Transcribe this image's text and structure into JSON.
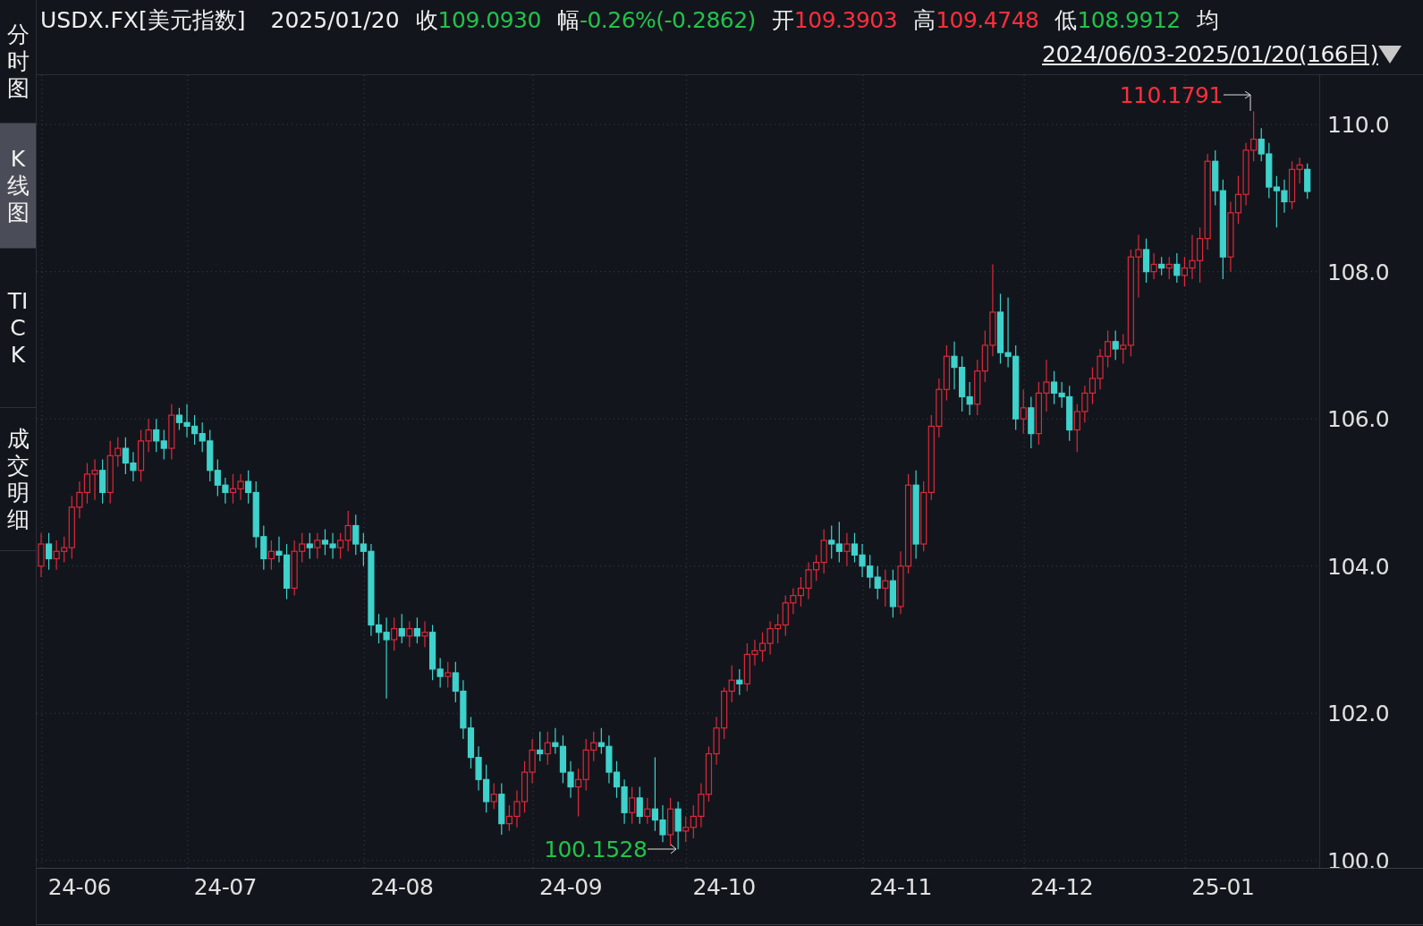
{
  "sidebar": {
    "tabs": [
      {
        "label": "分时图",
        "selected": false
      },
      {
        "label": "K线图",
        "selected": true
      },
      {
        "label": "TICK",
        "selected": false
      },
      {
        "label": "成交明细",
        "selected": false
      }
    ]
  },
  "header": {
    "symbol": "USDX.FX[美元指数]",
    "date": "2025/01/20",
    "quotes": [
      {
        "label": "收",
        "value": "109.0930",
        "color": "#22c24a"
      },
      {
        "label": "幅",
        "value": "-0.26%(-0.2862)",
        "color": "#22c24a"
      },
      {
        "label": "开",
        "value": "109.3903",
        "color": "#ff2e3c"
      },
      {
        "label": "高",
        "value": "109.4748",
        "color": "#ff2e3c"
      },
      {
        "label": "低",
        "value": "108.9912",
        "color": "#22c24a"
      },
      {
        "label": "均"
      }
    ],
    "range": "2024/06/03-2025/01/20(166日)"
  },
  "chart": {
    "chart_data": {
      "type": "candlestick",
      "yticks": [
        {
          "value": 110,
          "label": "110.0"
        },
        {
          "value": 108,
          "label": "108.0"
        },
        {
          "value": 106,
          "label": "106.0"
        },
        {
          "value": 104,
          "label": "104.0"
        },
        {
          "value": 102,
          "label": "102.0"
        },
        {
          "value": 100,
          "label": "100.0"
        }
      ],
      "ylim": [
        99.9,
        110.67
      ],
      "grid": true,
      "annotations": [
        "110.1791",
        "100.1528"
      ],
      "categories": [
        null,
        null,
        null,
        null,
        null,
        "24-06",
        null,
        null,
        null,
        null,
        null,
        null,
        null,
        null,
        null,
        null,
        null,
        null,
        null,
        null,
        null,
        null,
        null,
        null,
        "24-07",
        null,
        null,
        null,
        null,
        null,
        null,
        null,
        null,
        null,
        null,
        null,
        null,
        null,
        null,
        null,
        null,
        null,
        null,
        null,
        null,
        null,
        null,
        "24-08",
        null,
        null,
        null,
        null,
        null,
        null,
        null,
        null,
        null,
        null,
        null,
        null,
        null,
        null,
        null,
        null,
        null,
        null,
        null,
        null,
        null,
        "24-09",
        null,
        null,
        null,
        null,
        null,
        null,
        null,
        null,
        null,
        null,
        null,
        null,
        null,
        null,
        null,
        null,
        null,
        null,
        null,
        "24-10",
        null,
        null,
        null,
        null,
        null,
        null,
        null,
        null,
        null,
        null,
        null,
        null,
        null,
        null,
        null,
        null,
        null,
        null,
        null,
        null,
        null,
        null,
        "24-11",
        null,
        null,
        null,
        null,
        null,
        null,
        null,
        null,
        null,
        null,
        null,
        null,
        null,
        null,
        null,
        null,
        null,
        null,
        null,
        null,
        "24-12",
        null,
        null,
        null,
        null,
        null,
        null,
        null,
        null,
        null,
        null,
        null,
        null,
        null,
        null,
        null,
        null,
        null,
        null,
        null,
        null,
        "25-01",
        null,
        null,
        null,
        null,
        null,
        null,
        null,
        null,
        null,
        null,
        null
      ],
      "ohlc": [
        [
          104.0,
          104.45,
          103.85,
          104.3
        ],
        [
          104.3,
          104.45,
          103.95,
          104.1
        ],
        [
          104.1,
          104.35,
          103.95,
          104.2
        ],
        [
          104.2,
          104.4,
          104.05,
          104.25
        ],
        [
          104.25,
          104.95,
          104.1,
          104.8
        ],
        [
          104.8,
          105.15,
          104.65,
          105.0
        ],
        [
          105.0,
          105.4,
          104.85,
          105.25
        ],
        [
          105.25,
          105.45,
          104.9,
          105.3
        ],
        [
          105.3,
          105.45,
          104.85,
          105.0
        ],
        [
          105.0,
          105.7,
          104.85,
          105.5
        ],
        [
          105.5,
          105.75,
          105.35,
          105.6
        ],
        [
          105.6,
          105.75,
          105.25,
          105.4
        ],
        [
          105.4,
          105.55,
          105.15,
          105.3
        ],
        [
          105.3,
          105.85,
          105.15,
          105.7
        ],
        [
          105.7,
          106.0,
          105.55,
          105.85
        ],
        [
          105.85,
          106.0,
          105.55,
          105.7
        ],
        [
          105.7,
          105.85,
          105.45,
          105.6
        ],
        [
          105.6,
          106.2,
          105.45,
          106.05
        ],
        [
          106.05,
          106.15,
          105.85,
          105.95
        ],
        [
          105.95,
          106.2,
          105.75,
          105.9
        ],
        [
          105.9,
          106.05,
          105.65,
          105.8
        ],
        [
          105.8,
          105.95,
          105.55,
          105.7
        ],
        [
          105.7,
          105.85,
          105.15,
          105.3
        ],
        [
          105.3,
          105.45,
          104.95,
          105.1
        ],
        [
          105.1,
          105.2,
          104.85,
          105.0
        ],
        [
          105.0,
          105.25,
          104.85,
          105.05
        ],
        [
          105.05,
          105.25,
          104.9,
          105.15
        ],
        [
          105.15,
          105.3,
          104.85,
          105.0
        ],
        [
          105.0,
          105.15,
          104.25,
          104.4
        ],
        [
          104.4,
          104.55,
          103.95,
          104.1
        ],
        [
          104.1,
          104.35,
          103.95,
          104.2
        ],
        [
          104.2,
          104.4,
          104.05,
          104.15
        ],
        [
          104.15,
          104.3,
          103.55,
          103.7
        ],
        [
          103.7,
          104.35,
          103.6,
          104.2
        ],
        [
          104.2,
          104.45,
          104.05,
          104.3
        ],
        [
          104.3,
          104.45,
          104.1,
          104.25
        ],
        [
          104.25,
          104.45,
          104.1,
          104.35
        ],
        [
          104.35,
          104.5,
          104.15,
          104.3
        ],
        [
          104.3,
          104.45,
          104.1,
          104.25
        ],
        [
          104.25,
          104.45,
          104.1,
          104.35
        ],
        [
          104.35,
          104.75,
          104.2,
          104.55
        ],
        [
          104.55,
          104.7,
          104.15,
          104.3
        ],
        [
          104.3,
          104.45,
          104.0,
          104.2
        ],
        [
          104.2,
          104.3,
          103.05,
          103.2
        ],
        [
          103.2,
          103.35,
          102.95,
          103.1
        ],
        [
          103.1,
          103.3,
          102.2,
          103.0
        ],
        [
          103.0,
          103.3,
          102.85,
          103.15
        ],
        [
          103.15,
          103.35,
          102.95,
          103.05
        ],
        [
          103.05,
          103.25,
          102.9,
          103.15
        ],
        [
          103.15,
          103.3,
          102.95,
          103.05
        ],
        [
          103.05,
          103.25,
          102.9,
          103.1
        ],
        [
          103.1,
          103.2,
          102.45,
          102.6
        ],
        [
          102.6,
          102.75,
          102.35,
          102.5
        ],
        [
          102.5,
          102.7,
          102.35,
          102.55
        ],
        [
          102.55,
          102.7,
          102.15,
          102.3
        ],
        [
          102.3,
          102.45,
          101.65,
          101.8
        ],
        [
          101.8,
          101.95,
          101.25,
          101.4
        ],
        [
          101.4,
          101.55,
          100.95,
          101.1
        ],
        [
          101.1,
          101.3,
          100.65,
          100.8
        ],
        [
          100.8,
          101.05,
          100.7,
          100.9
        ],
        [
          100.9,
          101.05,
          100.35,
          100.5
        ],
        [
          100.5,
          100.75,
          100.4,
          100.6
        ],
        [
          100.6,
          100.95,
          100.45,
          100.8
        ],
        [
          100.8,
          101.35,
          100.65,
          101.2
        ],
        [
          101.2,
          101.65,
          101.05,
          101.5
        ],
        [
          101.5,
          101.75,
          101.35,
          101.45
        ],
        [
          101.45,
          101.75,
          101.3,
          101.6
        ],
        [
          101.6,
          101.8,
          101.45,
          101.55
        ],
        [
          101.55,
          101.7,
          101.05,
          101.2
        ],
        [
          101.2,
          101.35,
          100.85,
          101.0
        ],
        [
          101.0,
          101.25,
          100.6,
          101.1
        ],
        [
          101.1,
          101.65,
          100.95,
          101.5
        ],
        [
          101.5,
          101.75,
          101.35,
          101.6
        ],
        [
          101.6,
          101.8,
          101.45,
          101.55
        ],
        [
          101.55,
          101.7,
          101.05,
          101.2
        ],
        [
          101.2,
          101.35,
          100.85,
          101.0
        ],
        [
          101.0,
          101.1,
          100.5,
          100.65
        ],
        [
          100.65,
          101.0,
          100.5,
          100.85
        ],
        [
          100.85,
          101.0,
          100.5,
          100.6
        ],
        [
          100.6,
          100.85,
          100.5,
          100.7
        ],
        [
          100.7,
          101.4,
          100.4,
          100.55
        ],
        [
          100.55,
          100.75,
          100.25,
          100.35
        ],
        [
          100.35,
          100.85,
          100.2,
          100.7
        ],
        [
          100.7,
          100.8,
          100.1528,
          100.4
        ],
        [
          100.4,
          100.6,
          100.25,
          100.45
        ],
        [
          100.45,
          100.75,
          100.3,
          100.6
        ],
        [
          100.6,
          101.05,
          100.45,
          100.9
        ],
        [
          100.9,
          101.55,
          100.8,
          101.45
        ],
        [
          101.45,
          101.95,
          101.3,
          101.8
        ],
        [
          101.8,
          102.35,
          101.65,
          102.3
        ],
        [
          102.3,
          102.65,
          102.15,
          102.45
        ],
        [
          102.45,
          102.6,
          102.25,
          102.4
        ],
        [
          102.4,
          102.95,
          102.3,
          102.8
        ],
        [
          102.8,
          103.0,
          102.65,
          102.85
        ],
        [
          102.85,
          103.1,
          102.7,
          102.95
        ],
        [
          102.95,
          103.25,
          102.8,
          103.15
        ],
        [
          103.15,
          103.35,
          102.95,
          103.2
        ],
        [
          103.2,
          103.6,
          103.05,
          103.5
        ],
        [
          103.5,
          103.7,
          103.35,
          103.6
        ],
        [
          103.6,
          103.85,
          103.45,
          103.7
        ],
        [
          103.7,
          104.05,
          103.55,
          103.95
        ],
        [
          103.95,
          104.15,
          103.8,
          104.05
        ],
        [
          104.05,
          104.5,
          103.9,
          104.35
        ],
        [
          104.35,
          104.55,
          104.1,
          104.3
        ],
        [
          104.3,
          104.6,
          104.05,
          104.2
        ],
        [
          104.2,
          104.45,
          104.0,
          104.3
        ],
        [
          104.3,
          104.45,
          104.05,
          104.15
        ],
        [
          104.15,
          104.3,
          103.85,
          104.0
        ],
        [
          104.0,
          104.15,
          103.7,
          103.85
        ],
        [
          103.85,
          104.0,
          103.55,
          103.7
        ],
        [
          103.7,
          103.95,
          103.45,
          103.8
        ],
        [
          103.8,
          103.95,
          103.3,
          103.45
        ],
        [
          103.45,
          104.2,
          103.35,
          104.0
        ],
        [
          104.0,
          105.25,
          103.9,
          105.1
        ],
        [
          105.1,
          105.3,
          104.1,
          104.3
        ],
        [
          104.3,
          105.15,
          104.2,
          105.0
        ],
        [
          105.0,
          106.05,
          104.9,
          105.9
        ],
        [
          105.9,
          106.55,
          105.75,
          106.4
        ],
        [
          106.4,
          107.0,
          106.25,
          106.85
        ],
        [
          106.85,
          107.05,
          106.4,
          106.7
        ],
        [
          106.7,
          106.85,
          106.1,
          106.3
        ],
        [
          106.3,
          106.5,
          106.05,
          106.2
        ],
        [
          106.2,
          106.8,
          106.05,
          106.65
        ],
        [
          106.65,
          107.2,
          106.5,
          107.0
        ],
        [
          107.0,
          108.1,
          106.85,
          107.45
        ],
        [
          107.45,
          107.7,
          106.75,
          106.9
        ],
        [
          106.9,
          107.65,
          106.7,
          106.85
        ],
        [
          106.85,
          107.0,
          105.85,
          106.0
        ],
        [
          106.0,
          106.4,
          105.8,
          106.15
        ],
        [
          106.15,
          106.3,
          105.6,
          105.8
        ],
        [
          105.8,
          106.5,
          105.65,
          106.35
        ],
        [
          106.35,
          106.8,
          106.1,
          106.5
        ],
        [
          106.5,
          106.65,
          106.2,
          106.35
        ],
        [
          106.35,
          106.5,
          106.15,
          106.3
        ],
        [
          106.3,
          106.45,
          105.7,
          105.85
        ],
        [
          105.85,
          106.2,
          105.55,
          106.1
        ],
        [
          106.1,
          106.45,
          105.95,
          106.35
        ],
        [
          106.35,
          106.7,
          106.2,
          106.55
        ],
        [
          106.55,
          106.95,
          106.4,
          106.85
        ],
        [
          106.85,
          107.2,
          106.7,
          107.05
        ],
        [
          107.05,
          107.2,
          106.8,
          106.95
        ],
        [
          106.95,
          107.15,
          106.75,
          107.0
        ],
        [
          107.0,
          108.3,
          106.85,
          108.2
        ],
        [
          108.2,
          108.5,
          107.65,
          108.3
        ],
        [
          108.3,
          108.45,
          107.85,
          108.0
        ],
        [
          108.0,
          108.25,
          107.9,
          108.1
        ],
        [
          108.1,
          108.2,
          107.95,
          108.05
        ],
        [
          108.05,
          108.2,
          107.9,
          108.1
        ],
        [
          108.1,
          108.25,
          107.85,
          107.95
        ],
        [
          107.95,
          108.2,
          107.8,
          108.05
        ],
        [
          108.05,
          108.5,
          107.9,
          108.15
        ],
        [
          108.15,
          108.6,
          107.85,
          108.45
        ],
        [
          108.45,
          109.6,
          108.3,
          109.5
        ],
        [
          109.5,
          109.65,
          108.9,
          109.1
        ],
        [
          109.1,
          109.25,
          107.9,
          108.2
        ],
        [
          108.2,
          108.95,
          108.0,
          108.8
        ],
        [
          108.8,
          109.3,
          108.65,
          109.05
        ],
        [
          109.05,
          109.75,
          108.9,
          109.65
        ],
        [
          109.65,
          110.1791,
          109.5,
          109.8
        ],
        [
          109.8,
          109.95,
          109.5,
          109.6
        ],
        [
          109.6,
          109.75,
          109.0,
          109.15
        ],
        [
          109.15,
          109.3,
          108.6,
          109.1
        ],
        [
          109.1,
          109.25,
          108.8,
          108.95
        ],
        [
          108.95,
          109.5,
          108.85,
          109.39
        ],
        [
          109.39,
          109.55,
          109.2,
          109.45
        ],
        [
          109.39,
          109.47,
          108.99,
          109.09
        ]
      ]
    }
  }
}
